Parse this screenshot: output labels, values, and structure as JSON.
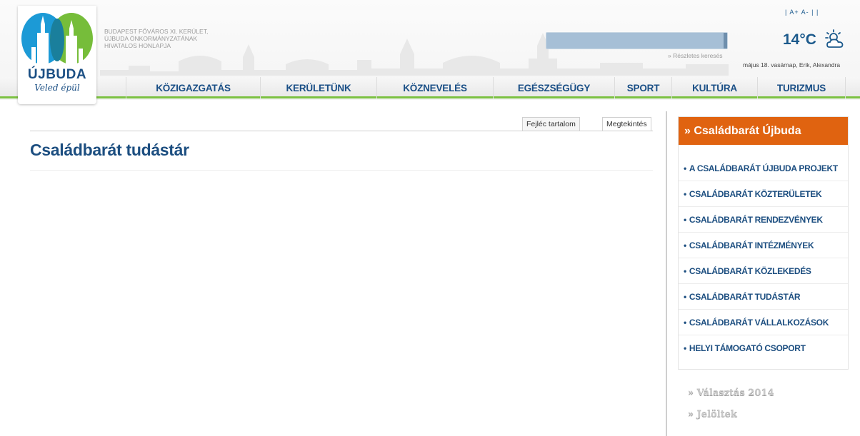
{
  "header": {
    "official_lines": [
      "BUDAPEST FŐVÁROS XI. KERÜLET,",
      "ÚJBUDA ÖNKORMÁNYZATÁNAK",
      "HIVATALOS HONLAPJA"
    ],
    "logo_name": "ÚJBUDA",
    "logo_tagline": "Veled épül",
    "advanced_search": "» Részletes keresés",
    "font_tools": "| A+ A- | |",
    "temperature": "14°C",
    "date_line": "május 18. vasárnap, Erik, Alexandra",
    "weather_icon": "partly-cloudy-icon",
    "colors": {
      "brand_blue": "#1c4e80",
      "accent_green": "#7cc142",
      "accent_orange": "#e06310"
    }
  },
  "nav": {
    "items": [
      "KÖZIGAZGATÁS",
      "KERÜLETÜNK",
      "KÖZNEVELÉS",
      "EGÉSZSÉGÜGY",
      "SPORT",
      "KULTÚRA",
      "TURIZMUS"
    ]
  },
  "main": {
    "tabs": [
      "Fejléc tartalom",
      "Megtekintés"
    ],
    "title": "Családbarát tudástár"
  },
  "sidebar": {
    "heading": "» Családbarát Újbuda",
    "items": [
      "A CSALÁDBARÁT ÚJBUDA PROJEKT",
      "CSALÁDBARÁT KÖZTERÜLETEK",
      "CSALÁDBARÁT RENDEZVÉNYEK",
      "CSALÁDBARÁT INTÉZMÉNYEK",
      "CSALÁDBARÁT KÖZLEKEDÉS",
      "CSALÁDBARÁT TUDÁSTÁR",
      "CSALÁDBARÁT VÁLLALKOZÁSOK",
      "HELYI TÁMOGATÓ CSOPORT"
    ],
    "links": [
      "» Választás 2014",
      "» Jelöltek"
    ]
  }
}
